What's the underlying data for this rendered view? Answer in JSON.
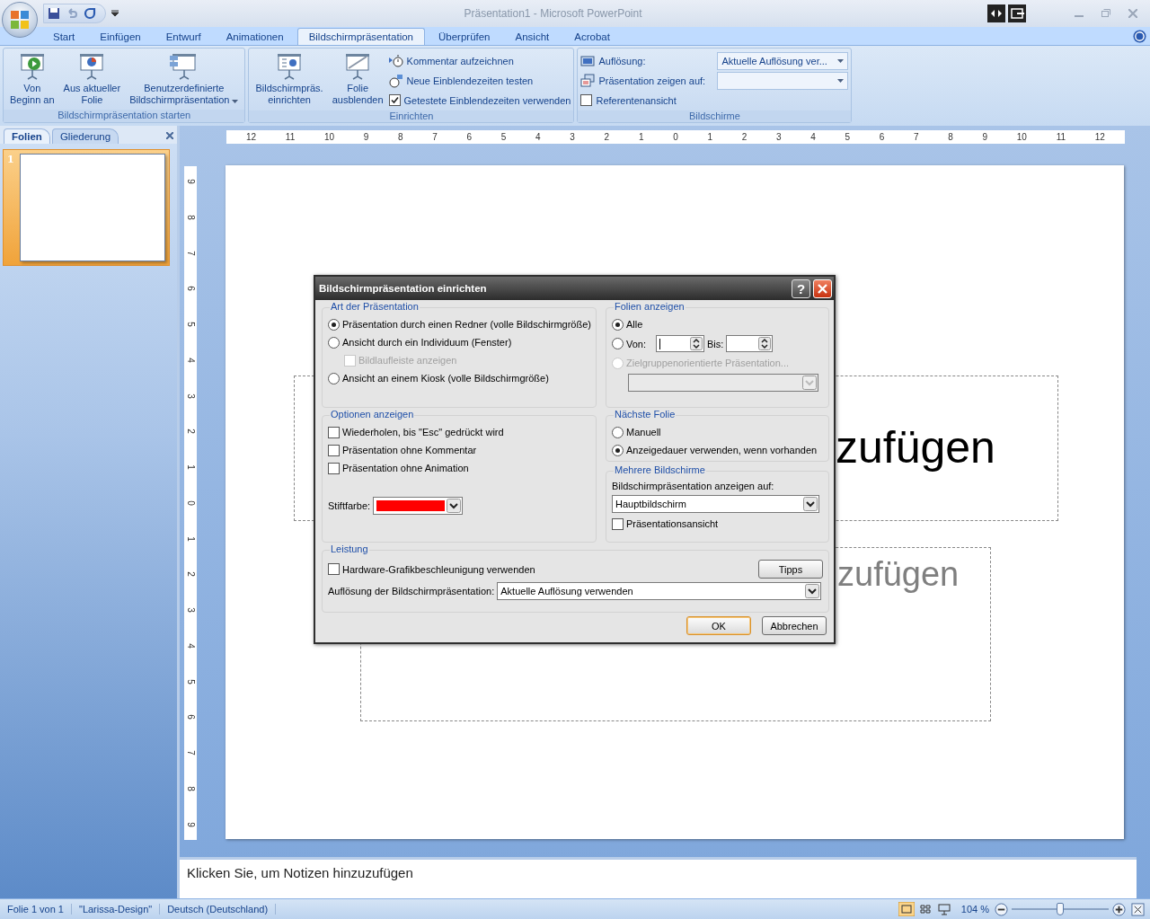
{
  "window": {
    "title": "Präsentation1 - Microsoft PowerPoint"
  },
  "ribbon_tabs": [
    {
      "label": "Start",
      "selected": false
    },
    {
      "label": "Einfügen",
      "selected": false
    },
    {
      "label": "Entwurf",
      "selected": false
    },
    {
      "label": "Animationen",
      "selected": false
    },
    {
      "label": "Bildschirmpräsentation",
      "selected": true
    },
    {
      "label": "Überprüfen",
      "selected": false
    },
    {
      "label": "Ansicht",
      "selected": false
    },
    {
      "label": "Acrobat",
      "selected": false
    }
  ],
  "ribbon_groups": [
    {
      "title": "Bildschirmpräsentation starten",
      "items": [
        {
          "kind": "large",
          "label": "Von\nBeginn an",
          "dropdown": false
        },
        {
          "kind": "large",
          "label": "Aus aktueller\nFolie",
          "dropdown": false
        },
        {
          "kind": "large",
          "label": "Benutzerdefinierte\nBildschirmpräsentation",
          "dropdown": true
        }
      ]
    },
    {
      "title": "Einrichten",
      "items": [
        {
          "kind": "large",
          "label": "Bildschirmpräs.\neinrichten",
          "dropdown": false
        },
        {
          "kind": "large",
          "label": "Folie\nausblenden",
          "dropdown": false
        },
        {
          "kind": "stack",
          "rows": [
            {
              "kind": "command",
              "label": "Kommentar aufzeichnen"
            },
            {
              "kind": "command",
              "label": "Neue Einblendezeiten testen"
            },
            {
              "kind": "check",
              "label": "Getestete Einblendezeiten verwenden",
              "checked": true
            }
          ]
        }
      ]
    },
    {
      "title": "Bildschirme",
      "items": [
        {
          "kind": "stack",
          "rows": [
            {
              "kind": "combo",
              "label": "Auflösung:",
              "value": "Aktuelle Auflösung ver..."
            },
            {
              "kind": "combo",
              "label": "Präsentation zeigen auf:"
            },
            {
              "kind": "check",
              "label": "Referentenansicht",
              "checked": false
            }
          ]
        }
      ]
    }
  ],
  "pane_tabs": [
    {
      "label": "Folien",
      "selected": true
    },
    {
      "label": "Gliederung",
      "selected": false
    }
  ],
  "slides": [
    {
      "number": "1",
      "selected": true
    }
  ],
  "ruler_h": [
    "12",
    "11",
    "10",
    "9",
    "8",
    "7",
    "6",
    "5",
    "4",
    "3",
    "2",
    "1",
    "0",
    "1",
    "2",
    "3",
    "4",
    "5",
    "6",
    "7",
    "8",
    "9",
    "10",
    "11",
    "12"
  ],
  "ruler_v": [
    "9",
    "8",
    "7",
    "6",
    "5",
    "4",
    "3",
    "2",
    "1",
    "0",
    "1",
    "2",
    "3",
    "4",
    "5",
    "6",
    "7",
    "8",
    "9"
  ],
  "slide": {
    "title_visible": "zufügen",
    "subtitle_visible": "zufügen"
  },
  "notes": {
    "placeholder": "Klicken Sie, um Notizen hinzuzufügen"
  },
  "dialog": {
    "title": "Bildschirmpräsentation einrichten",
    "help": "?",
    "art": {
      "title": "Art der Präsentation",
      "options": [
        {
          "kind": "radio",
          "label": "Präsentation durch einen Redner (volle Bildschirmgröße)",
          "selected": true,
          "disabled": false
        },
        {
          "kind": "radio",
          "label": "Ansicht durch ein Individuum (Fenster)",
          "selected": false,
          "disabled": false
        },
        {
          "kind": "subcheck",
          "label": "Bildlaufleiste anzeigen",
          "checked": false,
          "disabled": true
        },
        {
          "kind": "radio",
          "label": "Ansicht an einem Kiosk (volle Bildschirmgröße)",
          "selected": false,
          "disabled": false
        }
      ]
    },
    "folien": {
      "title": "Folien anzeigen",
      "all": {
        "label": "Alle",
        "selected": true
      },
      "range": {
        "label": "Von:",
        "selected": false,
        "to_label": "Bis:"
      },
      "custom": {
        "label": "Zielgruppenorientierte Präsentation...",
        "selected": false,
        "disabled": true
      }
    },
    "optionen": {
      "title": "Optionen anzeigen",
      "checks": [
        {
          "label": "Wiederholen, bis \"Esc\" gedrückt wird",
          "checked": false
        },
        {
          "label": "Präsentation ohne Kommentar",
          "checked": false
        },
        {
          "label": "Präsentation ohne Animation",
          "checked": false
        }
      ],
      "pen_label": "Stiftfarbe:"
    },
    "naechste": {
      "title": "Nächste Folie",
      "options": [
        {
          "label": "Manuell",
          "selected": false
        },
        {
          "label": "Anzeigedauer verwenden, wenn vorhanden",
          "selected": true
        }
      ]
    },
    "mehrere": {
      "title": "Mehrere Bildschirme",
      "label": "Bildschirmpräsentation anzeigen auf:",
      "value": "Hauptbildschirm",
      "check": {
        "label": "Präsentationsansicht",
        "checked": false
      }
    },
    "leistung": {
      "title": "Leistung",
      "check": {
        "label": "Hardware-Grafikbeschleunigung verwenden",
        "checked": false
      },
      "tips": "Tipps",
      "res_label": "Auflösung der Bildschirmpräsentation:",
      "res_value": "Aktuelle Auflösung verwenden"
    },
    "buttons": [
      {
        "label": "OK",
        "default": true
      },
      {
        "label": "Abbrechen",
        "default": false
      }
    ]
  },
  "status_bar": {
    "items": [
      "Folie 1 von 1",
      "\"Larissa-Design\"",
      "Deutsch (Deutschland)"
    ],
    "zoom": "104 %",
    "level": 0.5
  }
}
